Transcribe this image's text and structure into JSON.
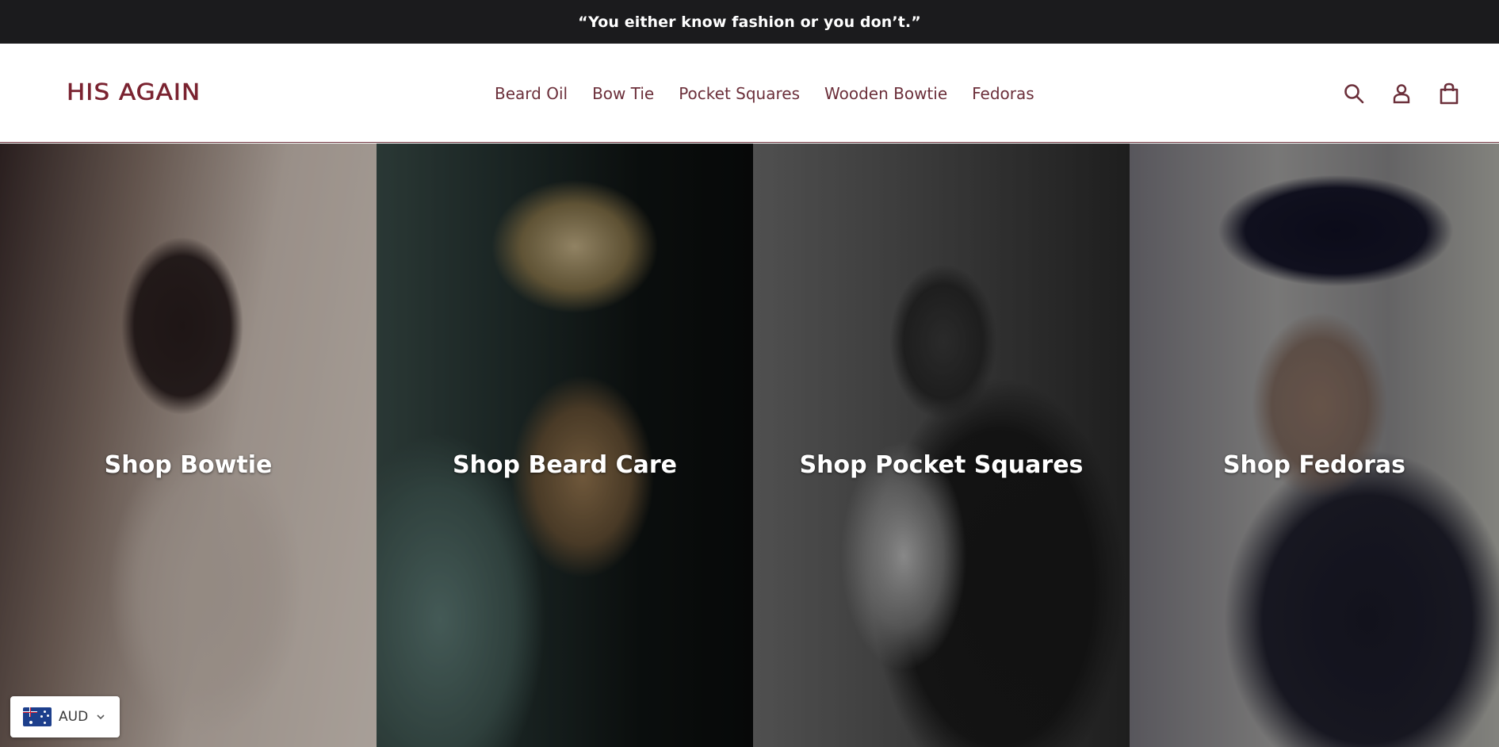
{
  "announcement": {
    "text": "“You either know fashion or you don’t.”"
  },
  "header": {
    "logo_text": "HIS AGAIN",
    "nav": [
      {
        "label": "Beard Oil"
      },
      {
        "label": "Bow Tie"
      },
      {
        "label": "Pocket Squares"
      },
      {
        "label": "Wooden Bowtie"
      },
      {
        "label": "Fedoras"
      }
    ],
    "icons": [
      "search-icon",
      "account-icon",
      "cart-icon"
    ]
  },
  "collage": {
    "tiles": [
      {
        "label": "Shop Bowtie"
      },
      {
        "label": "Shop Beard Care"
      },
      {
        "label": "Shop Pocket Squares"
      },
      {
        "label": "Shop Fedoras"
      }
    ]
  },
  "currency_selector": {
    "code": "AUD",
    "flag_icon": "australia-flag-icon"
  },
  "colors": {
    "brand": "#7a2330",
    "nav_text": "#6b2f3a",
    "announcement_bg": "#1b1b1d"
  }
}
